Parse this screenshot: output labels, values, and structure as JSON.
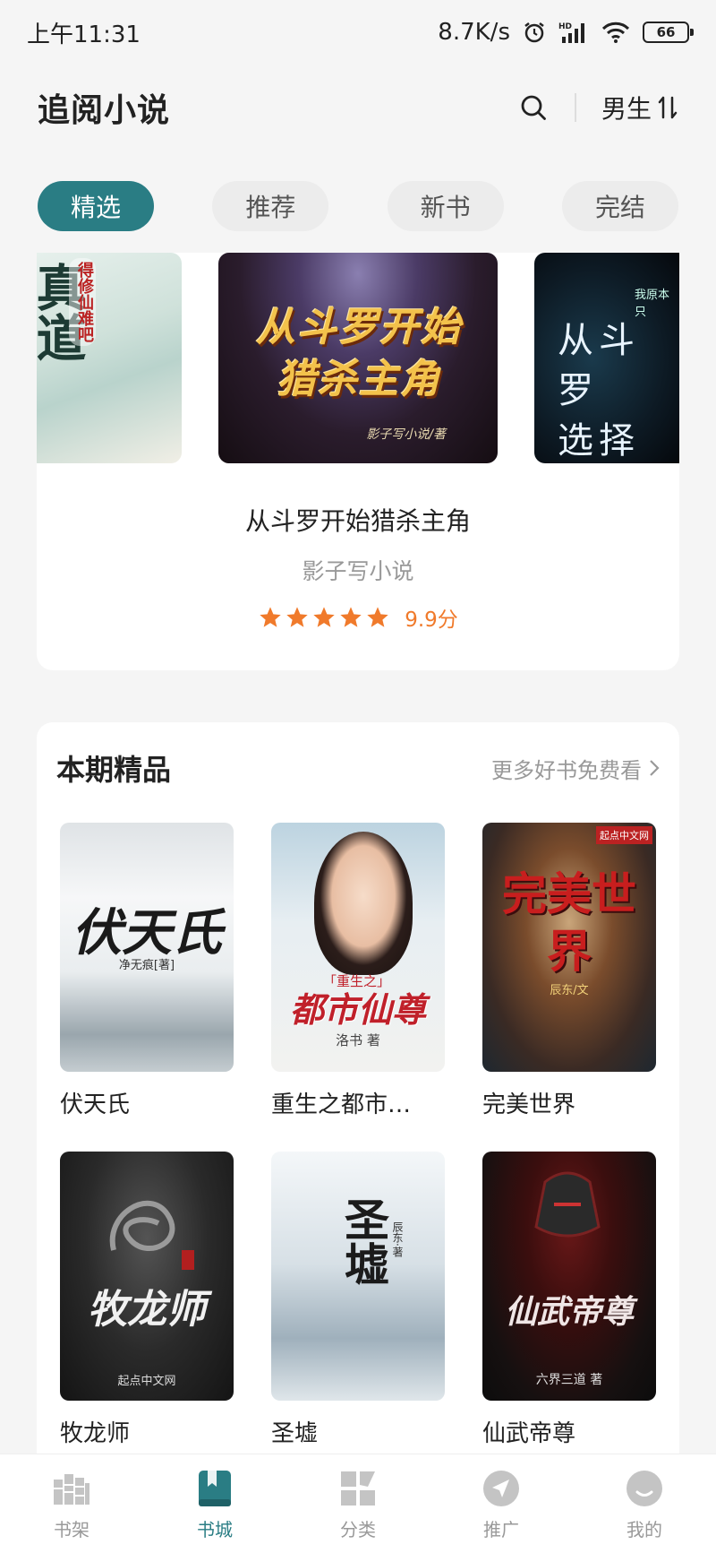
{
  "status_bar": {
    "time": "上午11:31",
    "network_speed": "8.7K/s",
    "battery": "66",
    "icons": [
      "alarm-icon",
      "hd-signal-icon",
      "wifi-icon",
      "battery-icon"
    ]
  },
  "header": {
    "title": "追阅小说",
    "gender_label": "男生",
    "search_icon": "search-icon",
    "switch_icon": "swap-icon"
  },
  "tabs": [
    {
      "label": "精选",
      "active": true
    },
    {
      "label": "推荐",
      "active": false
    },
    {
      "label": "新书",
      "active": false
    },
    {
      "label": "完结",
      "active": false
    }
  ],
  "featured": {
    "left_cover": {
      "tag": "得修仙难吧"
    },
    "center_cover": {
      "title_line1": "从斗罗开始",
      "title_line2": "猎杀主角",
      "author": "影子写小说/著"
    },
    "right_cover": {
      "small": "我原本只",
      "title_line1": "从斗罗",
      "title_line2": "选择"
    },
    "title": "从斗罗开始猎杀主角",
    "author": "影子写小说",
    "stars": 5,
    "score": "9.9分"
  },
  "section": {
    "title": "本期精品",
    "more_label": "更多好书免费看",
    "books": [
      {
        "title": "伏天氏",
        "cover_text": "伏天氏",
        "cover_author": "净无痕[著]"
      },
      {
        "title": "重生之都市…",
        "cover_text": "都市仙尊",
        "cover_tag": "「重生之」",
        "cover_author": "洛书 著"
      },
      {
        "title": "完美世界",
        "cover_text": "完美世界",
        "cover_badge": "起点中文网",
        "cover_author": "辰东/文"
      },
      {
        "title": "牧龙师",
        "cover_text": "牧龙师",
        "cover_logo": "起点中文网"
      },
      {
        "title": "圣墟",
        "cover_text": "圣墟",
        "cover_author": "辰东·著"
      },
      {
        "title": "仙武帝尊",
        "cover_text": "仙武帝尊",
        "cover_author": "六界三道 著"
      }
    ]
  },
  "bottom_nav": [
    {
      "label": "书架",
      "icon": "bookshelf-icon",
      "active": false
    },
    {
      "label": "书城",
      "icon": "book-icon",
      "active": true
    },
    {
      "label": "分类",
      "icon": "category-icon",
      "active": false
    },
    {
      "label": "推广",
      "icon": "send-icon",
      "active": false
    },
    {
      "label": "我的",
      "icon": "profile-icon",
      "active": false
    }
  ],
  "colors": {
    "accent": "#2a7d84",
    "rating": "#f07a2b",
    "background": "#f5f5f5"
  }
}
